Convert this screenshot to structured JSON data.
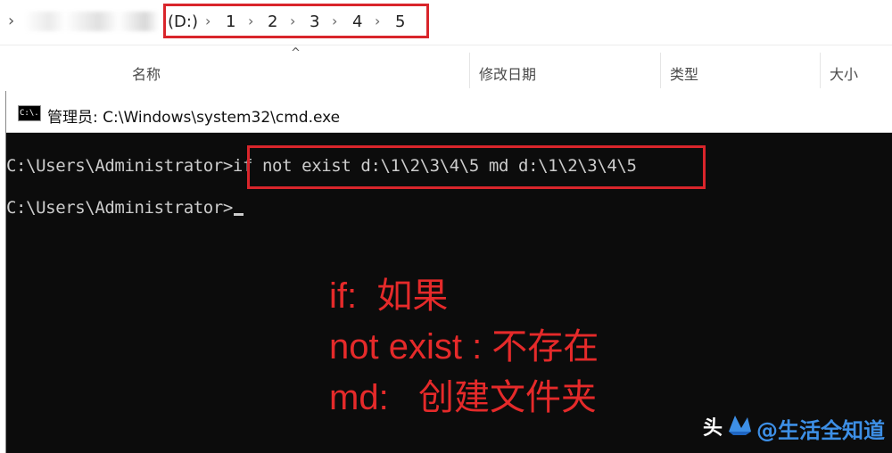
{
  "explorer": {
    "address": {
      "drive": "(D:)",
      "segments": [
        "1",
        "2",
        "3",
        "4",
        "5"
      ]
    },
    "columns": {
      "name": "名称",
      "modified": "修改日期",
      "type": "类型",
      "size": "大小"
    }
  },
  "cmd_window": {
    "title": "管理员: C:\\Windows\\system32\\cmd.exe",
    "icon_label": "C:\\.",
    "lines": {
      "line1_prompt": "C:\\Users\\Administrator>",
      "line1_command": "if not exist d:\\1\\2\\3\\4\\5 md d:\\1\\2\\3\\4\\5",
      "line2_prompt": "C:\\Users\\Administrator>"
    },
    "annotations": {
      "if": "if:  如果",
      "not_exist": "not exist : 不存在",
      "md": "md:   创建文件夹"
    }
  },
  "watermark": {
    "prefix": "头",
    "label": "@生活全知道"
  },
  "colors": {
    "highlight_red": "#d9252b",
    "annotation_red": "#e52a2a",
    "terminal_bg": "#0c0c0c",
    "terminal_text": "#cccccc"
  }
}
